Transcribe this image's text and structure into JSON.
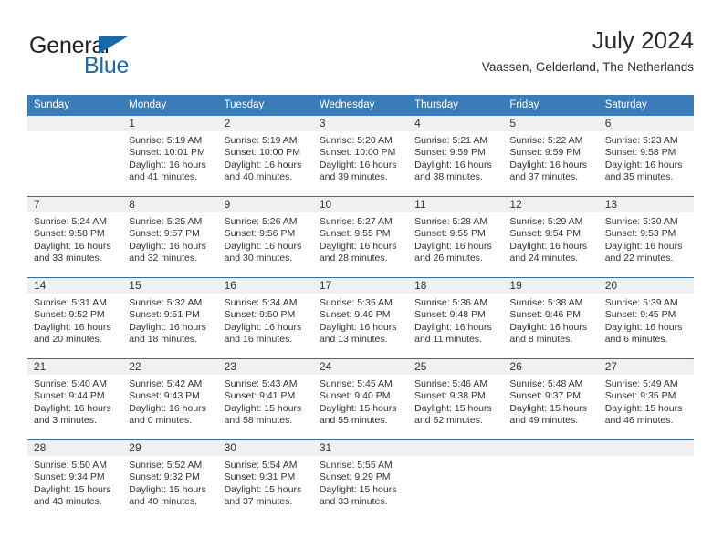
{
  "brand": {
    "word_one": "General",
    "word_two": "Blue",
    "flag_icon": "triangle-flag-icon"
  },
  "header": {
    "title": "July 2024",
    "subtitle": "Vaassen, Gelderland, The Netherlands"
  },
  "colors": {
    "header_blue": "#3a7cba",
    "rule_blue": "#2f6fa8",
    "daynum_band": "#f0f0f0",
    "brand_blue": "#1769aa",
    "text": "#333333"
  },
  "calendar": {
    "columns": [
      "Sunday",
      "Monday",
      "Tuesday",
      "Wednesday",
      "Thursday",
      "Friday",
      "Saturday"
    ],
    "weeks": [
      [
        {
          "day": "",
          "lines": []
        },
        {
          "day": "1",
          "lines": [
            "Sunrise: 5:19 AM",
            "Sunset: 10:01 PM",
            "Daylight: 16 hours",
            "and 41 minutes."
          ]
        },
        {
          "day": "2",
          "lines": [
            "Sunrise: 5:19 AM",
            "Sunset: 10:00 PM",
            "Daylight: 16 hours",
            "and 40 minutes."
          ]
        },
        {
          "day": "3",
          "lines": [
            "Sunrise: 5:20 AM",
            "Sunset: 10:00 PM",
            "Daylight: 16 hours",
            "and 39 minutes."
          ]
        },
        {
          "day": "4",
          "lines": [
            "Sunrise: 5:21 AM",
            "Sunset: 9:59 PM",
            "Daylight: 16 hours",
            "and 38 minutes."
          ]
        },
        {
          "day": "5",
          "lines": [
            "Sunrise: 5:22 AM",
            "Sunset: 9:59 PM",
            "Daylight: 16 hours",
            "and 37 minutes."
          ]
        },
        {
          "day": "6",
          "lines": [
            "Sunrise: 5:23 AM",
            "Sunset: 9:58 PM",
            "Daylight: 16 hours",
            "and 35 minutes."
          ]
        }
      ],
      [
        {
          "day": "7",
          "lines": [
            "Sunrise: 5:24 AM",
            "Sunset: 9:58 PM",
            "Daylight: 16 hours",
            "and 33 minutes."
          ]
        },
        {
          "day": "8",
          "lines": [
            "Sunrise: 5:25 AM",
            "Sunset: 9:57 PM",
            "Daylight: 16 hours",
            "and 32 minutes."
          ]
        },
        {
          "day": "9",
          "lines": [
            "Sunrise: 5:26 AM",
            "Sunset: 9:56 PM",
            "Daylight: 16 hours",
            "and 30 minutes."
          ]
        },
        {
          "day": "10",
          "lines": [
            "Sunrise: 5:27 AM",
            "Sunset: 9:55 PM",
            "Daylight: 16 hours",
            "and 28 minutes."
          ]
        },
        {
          "day": "11",
          "lines": [
            "Sunrise: 5:28 AM",
            "Sunset: 9:55 PM",
            "Daylight: 16 hours",
            "and 26 minutes."
          ]
        },
        {
          "day": "12",
          "lines": [
            "Sunrise: 5:29 AM",
            "Sunset: 9:54 PM",
            "Daylight: 16 hours",
            "and 24 minutes."
          ]
        },
        {
          "day": "13",
          "lines": [
            "Sunrise: 5:30 AM",
            "Sunset: 9:53 PM",
            "Daylight: 16 hours",
            "and 22 minutes."
          ]
        }
      ],
      [
        {
          "day": "14",
          "lines": [
            "Sunrise: 5:31 AM",
            "Sunset: 9:52 PM",
            "Daylight: 16 hours",
            "and 20 minutes."
          ]
        },
        {
          "day": "15",
          "lines": [
            "Sunrise: 5:32 AM",
            "Sunset: 9:51 PM",
            "Daylight: 16 hours",
            "and 18 minutes."
          ]
        },
        {
          "day": "16",
          "lines": [
            "Sunrise: 5:34 AM",
            "Sunset: 9:50 PM",
            "Daylight: 16 hours",
            "and 16 minutes."
          ]
        },
        {
          "day": "17",
          "lines": [
            "Sunrise: 5:35 AM",
            "Sunset: 9:49 PM",
            "Daylight: 16 hours",
            "and 13 minutes."
          ]
        },
        {
          "day": "18",
          "lines": [
            "Sunrise: 5:36 AM",
            "Sunset: 9:48 PM",
            "Daylight: 16 hours",
            "and 11 minutes."
          ]
        },
        {
          "day": "19",
          "lines": [
            "Sunrise: 5:38 AM",
            "Sunset: 9:46 PM",
            "Daylight: 16 hours",
            "and 8 minutes."
          ]
        },
        {
          "day": "20",
          "lines": [
            "Sunrise: 5:39 AM",
            "Sunset: 9:45 PM",
            "Daylight: 16 hours",
            "and 6 minutes."
          ]
        }
      ],
      [
        {
          "day": "21",
          "lines": [
            "Sunrise: 5:40 AM",
            "Sunset: 9:44 PM",
            "Daylight: 16 hours",
            "and 3 minutes."
          ]
        },
        {
          "day": "22",
          "lines": [
            "Sunrise: 5:42 AM",
            "Sunset: 9:43 PM",
            "Daylight: 16 hours",
            "and 0 minutes."
          ]
        },
        {
          "day": "23",
          "lines": [
            "Sunrise: 5:43 AM",
            "Sunset: 9:41 PM",
            "Daylight: 15 hours",
            "and 58 minutes."
          ]
        },
        {
          "day": "24",
          "lines": [
            "Sunrise: 5:45 AM",
            "Sunset: 9:40 PM",
            "Daylight: 15 hours",
            "and 55 minutes."
          ]
        },
        {
          "day": "25",
          "lines": [
            "Sunrise: 5:46 AM",
            "Sunset: 9:38 PM",
            "Daylight: 15 hours",
            "and 52 minutes."
          ]
        },
        {
          "day": "26",
          "lines": [
            "Sunrise: 5:48 AM",
            "Sunset: 9:37 PM",
            "Daylight: 15 hours",
            "and 49 minutes."
          ]
        },
        {
          "day": "27",
          "lines": [
            "Sunrise: 5:49 AM",
            "Sunset: 9:35 PM",
            "Daylight: 15 hours",
            "and 46 minutes."
          ]
        }
      ],
      [
        {
          "day": "28",
          "lines": [
            "Sunrise: 5:50 AM",
            "Sunset: 9:34 PM",
            "Daylight: 15 hours",
            "and 43 minutes."
          ]
        },
        {
          "day": "29",
          "lines": [
            "Sunrise: 5:52 AM",
            "Sunset: 9:32 PM",
            "Daylight: 15 hours",
            "and 40 minutes."
          ]
        },
        {
          "day": "30",
          "lines": [
            "Sunrise: 5:54 AM",
            "Sunset: 9:31 PM",
            "Daylight: 15 hours",
            "and 37 minutes."
          ]
        },
        {
          "day": "31",
          "lines": [
            "Sunrise: 5:55 AM",
            "Sunset: 9:29 PM",
            "Daylight: 15 hours",
            "and 33 minutes."
          ]
        },
        {
          "day": "",
          "lines": []
        },
        {
          "day": "",
          "lines": []
        },
        {
          "day": "",
          "lines": []
        }
      ]
    ]
  }
}
